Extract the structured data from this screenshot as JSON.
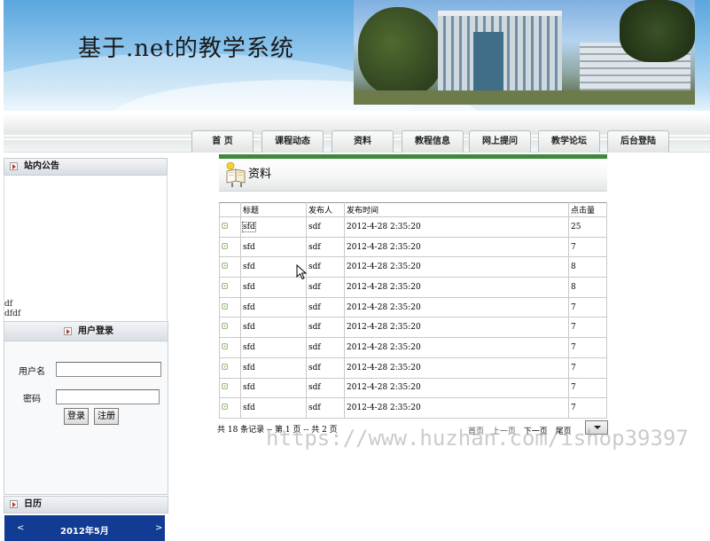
{
  "site": {
    "title": "基于.net的教学系统"
  },
  "nav": {
    "items": [
      "首 页",
      "课程动态",
      "资料",
      "教程信息",
      "网上提问",
      "教学论坛",
      "后台登陆"
    ]
  },
  "sidebar": {
    "notice_title": "站内公告",
    "notices": [
      "df",
      "dfdf"
    ],
    "login": {
      "title": "用户登录",
      "username_label": "用户名",
      "password_label": "密码",
      "username_value": "",
      "password_value": "",
      "login_button": "登录",
      "register_button": "注册"
    },
    "calendar": {
      "title": "日历",
      "prev": "<",
      "month": "2012年5月",
      "next": ">"
    }
  },
  "main": {
    "section_title": "资料",
    "columns": [
      "",
      "标题",
      "发布人",
      "发布时间",
      "点击量"
    ],
    "rows": [
      {
        "title": "sfd",
        "author": "sdf",
        "time": "2012-4-28 2:35:20",
        "clicks": "25"
      },
      {
        "title": "sfd",
        "author": "sdf",
        "time": "2012-4-28 2:35:20",
        "clicks": "7"
      },
      {
        "title": "sfd",
        "author": "sdf",
        "time": "2012-4-28 2:35:20",
        "clicks": "8"
      },
      {
        "title": "sfd",
        "author": "sdf",
        "time": "2012-4-28 2:35:20",
        "clicks": "8"
      },
      {
        "title": "sfd",
        "author": "sdf",
        "time": "2012-4-28 2:35:20",
        "clicks": "7"
      },
      {
        "title": "sfd",
        "author": "sdf",
        "time": "2012-4-28 2:35:20",
        "clicks": "7"
      },
      {
        "title": "sfd",
        "author": "sdf",
        "time": "2012-4-28 2:35:20",
        "clicks": "7"
      },
      {
        "title": "sfd",
        "author": "sdf",
        "time": "2012-4-28 2:35:20",
        "clicks": "7"
      },
      {
        "title": "sfd",
        "author": "sdf",
        "time": "2012-4-28 2:35:20",
        "clicks": "7"
      },
      {
        "title": "sfd",
        "author": "sdf",
        "time": "2012-4-28 2:35:20",
        "clicks": "7"
      }
    ],
    "pager": {
      "summary": "共 18 条记录 -- 第 1 页 -- 共 2 页",
      "first": "首页",
      "prev": "上一页",
      "next": "下一页",
      "last": "尾页"
    }
  },
  "watermark": "https://www.huzhan.com/ishop39397",
  "colors": {
    "nav_accent": "#3d8a3d",
    "calendar_bar": "#123b93"
  }
}
